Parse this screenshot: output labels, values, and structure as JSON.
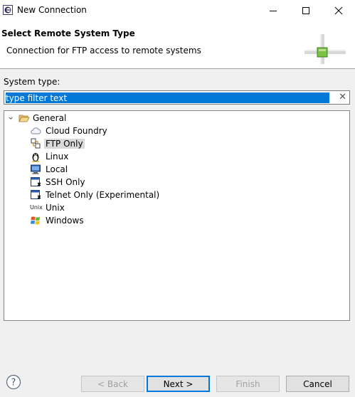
{
  "window": {
    "title": "New Connection"
  },
  "banner": {
    "title": "Select Remote System Type",
    "description": "Connection for FTP access to remote systems"
  },
  "system_type": {
    "label": "System type:",
    "filter_value": "type filter text"
  },
  "tree": {
    "root": {
      "label": "General",
      "expanded": true
    },
    "items": [
      {
        "label": "Cloud Foundry",
        "icon": "cloud-icon"
      },
      {
        "label": "FTP Only",
        "icon": "ftp-icon",
        "selected": true
      },
      {
        "label": "Linux",
        "icon": "linux-penguin-icon"
      },
      {
        "label": "Local",
        "icon": "monitor-icon"
      },
      {
        "label": "SSH Only",
        "icon": "ssh-terminal-icon"
      },
      {
        "label": "Telnet Only (Experimental)",
        "icon": "telnet-terminal-icon"
      },
      {
        "label": "Unix",
        "icon": "unix-icon",
        "icon_text": "Unix"
      },
      {
        "label": "Windows",
        "icon": "windows-flag-icon"
      }
    ]
  },
  "buttons": {
    "back": "< Back",
    "next": "Next >",
    "finish": "Finish",
    "cancel": "Cancel"
  },
  "colors": {
    "selection": "#0078d7",
    "accent_green": "#7cc242"
  }
}
